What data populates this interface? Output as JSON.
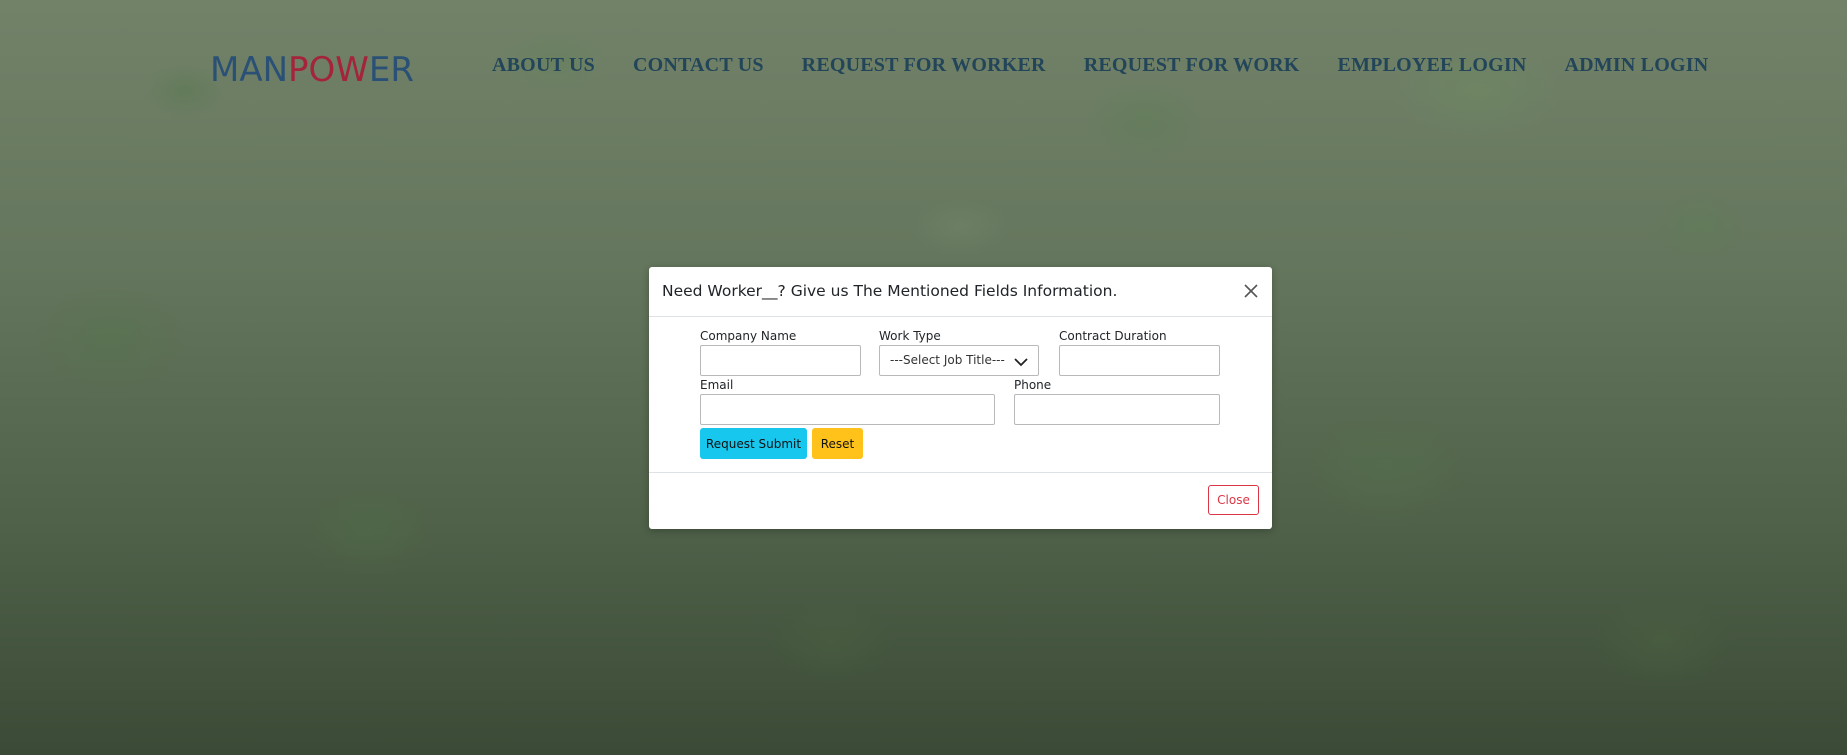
{
  "navbar": {
    "logo": {
      "part1": "MAN",
      "part2": "POW",
      "part3": "ER"
    },
    "links": [
      "ABOUT US",
      "CONTACT US",
      "REQUEST FOR WORKER",
      "REQUEST FOR WORK",
      "EMPLOYEE LOGIN",
      "ADMIN LOGIN"
    ]
  },
  "modal": {
    "title": "Need Worker__? Give us The Mentioned Fields Information.",
    "close_icon": "close-x-icon",
    "fields": {
      "company_name": {
        "label": "Company Name",
        "value": ""
      },
      "work_type": {
        "label": "Work Type",
        "selected": "---Select Job Title---"
      },
      "contract_duration": {
        "label": "Contract Duration",
        "value": ""
      },
      "email": {
        "label": "Email",
        "value": ""
      },
      "phone": {
        "label": "Phone",
        "value": ""
      }
    },
    "buttons": {
      "submit": "Request Submit",
      "reset": "Reset",
      "close": "Close"
    }
  },
  "colors": {
    "logo_blue": "#2a5175",
    "logo_red": "#a4243b",
    "nav_text": "#234559",
    "submit_bg": "#17c7ee",
    "reset_bg": "#ffc21a",
    "close_border": "#dc3545"
  }
}
